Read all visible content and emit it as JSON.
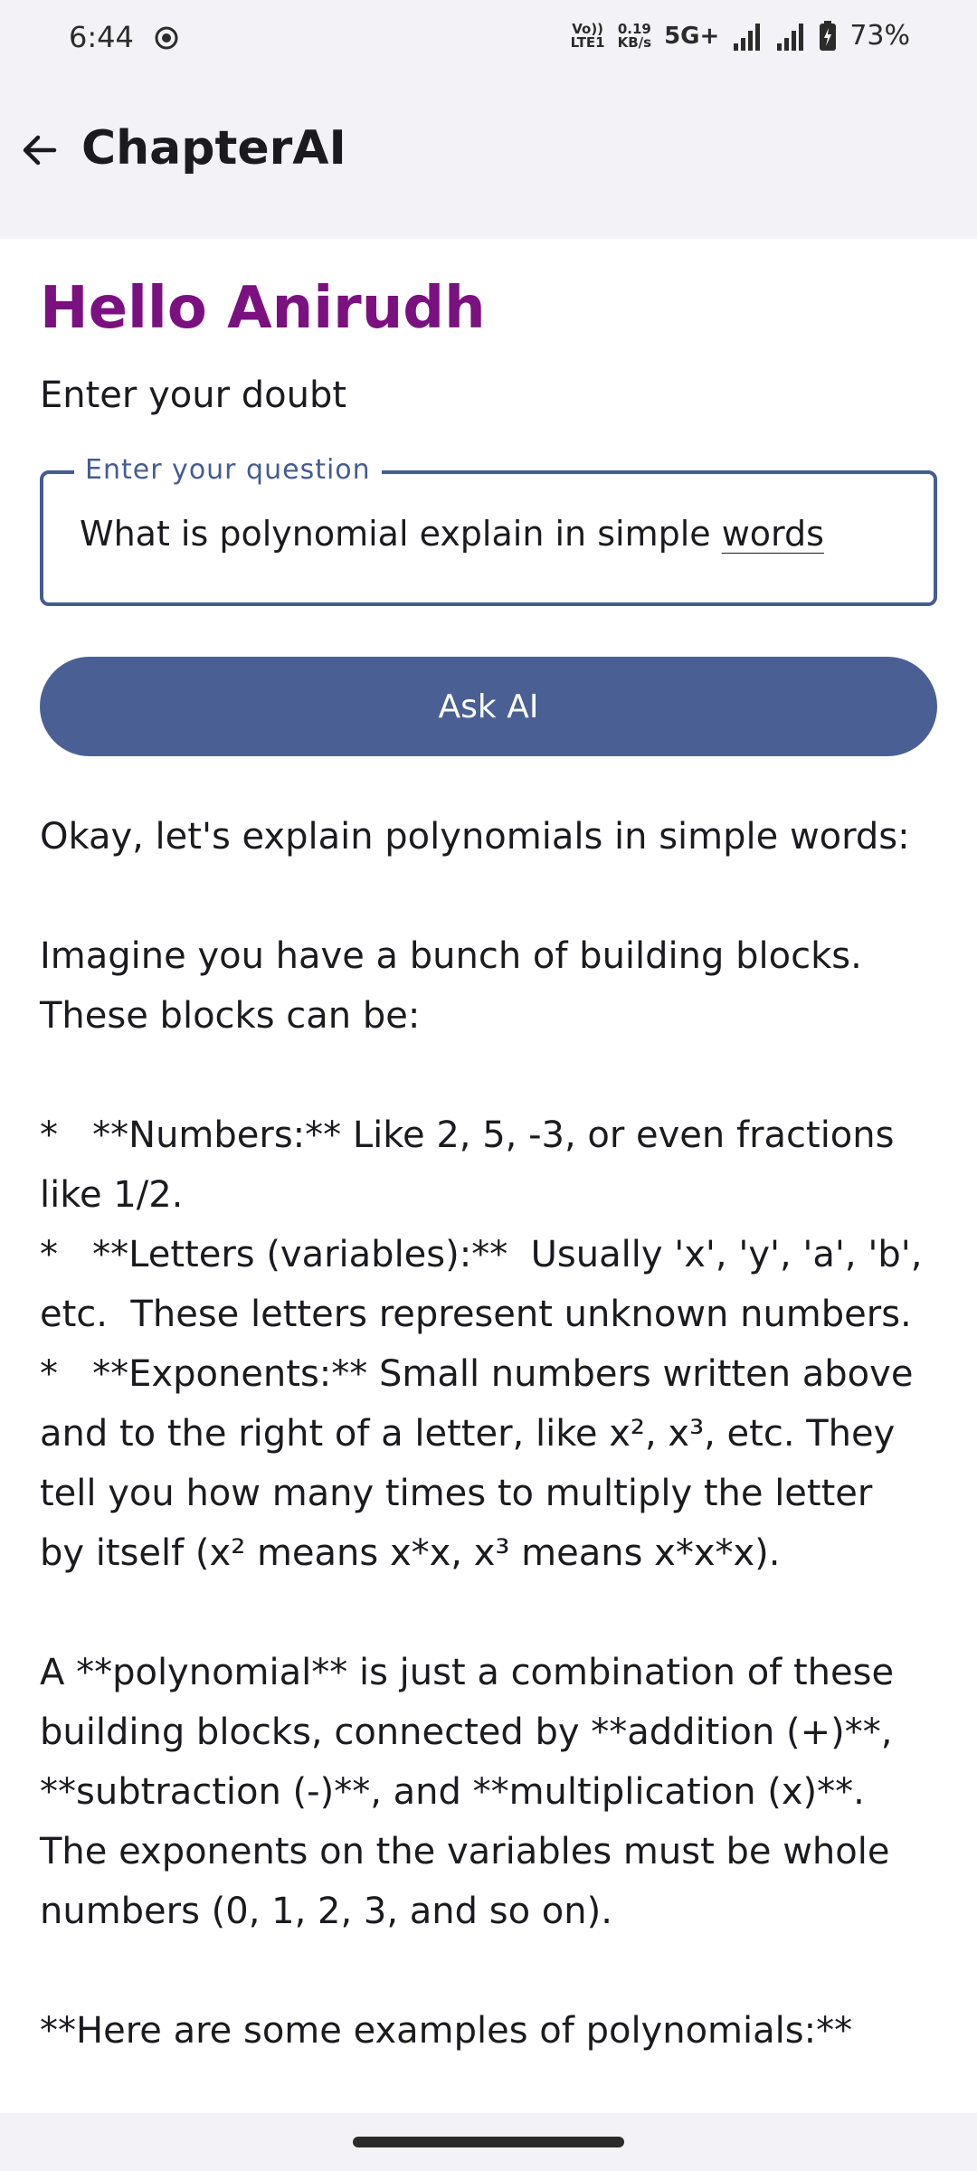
{
  "status": {
    "time": "6:44",
    "volte_top": "Vo))",
    "volte_bottom": "LTE1",
    "speed_top": "0.19",
    "speed_bottom": "KB/s",
    "network": "5G+",
    "battery": "73%"
  },
  "app_bar": {
    "title": "ChapterAI"
  },
  "greeting": "Hello Anirudh",
  "prompt_label": "Enter your doubt",
  "question_field": {
    "label": "Enter your question",
    "value_main": "What is polynomial explain in simple ",
    "value_underlined": "words"
  },
  "ask_button": "Ask AI",
  "answer": {
    "line1": "Okay, let's explain polynomials in simple words:",
    "line2": "Imagine you have a bunch of building blocks.",
    "line3": "These blocks can be:",
    "bullet1a": "*   **Numbers:** Like 2, 5, -3, or even fractions",
    "bullet1b": "like 1/2.",
    "bullet2a": "*   **Letters (variables):**  Usually 'x', 'y', 'a', 'b',",
    "bullet2b": "etc.  These letters represent unknown numbers.",
    "bullet3a": "*   **Exponents:** Small numbers written above",
    "bullet3b": "and to the right of a letter, like x², x³, etc. They",
    "bullet3c": "tell you how many times to multiply the letter",
    "bullet3d": "by itself (x² means x*x, x³ means x*x*x).",
    "para1": "A **polynomial** is just a combination of these",
    "para2": "building blocks, connected by **addition (+)**,",
    "para3": "**subtraction (-)**, and **multiplication (x)**.",
    "para4": "The exponents on the variables must be whole",
    "para5": "numbers (0, 1, 2, 3, and so on).",
    "examples": "**Here are some examples of polynomials:**"
  }
}
